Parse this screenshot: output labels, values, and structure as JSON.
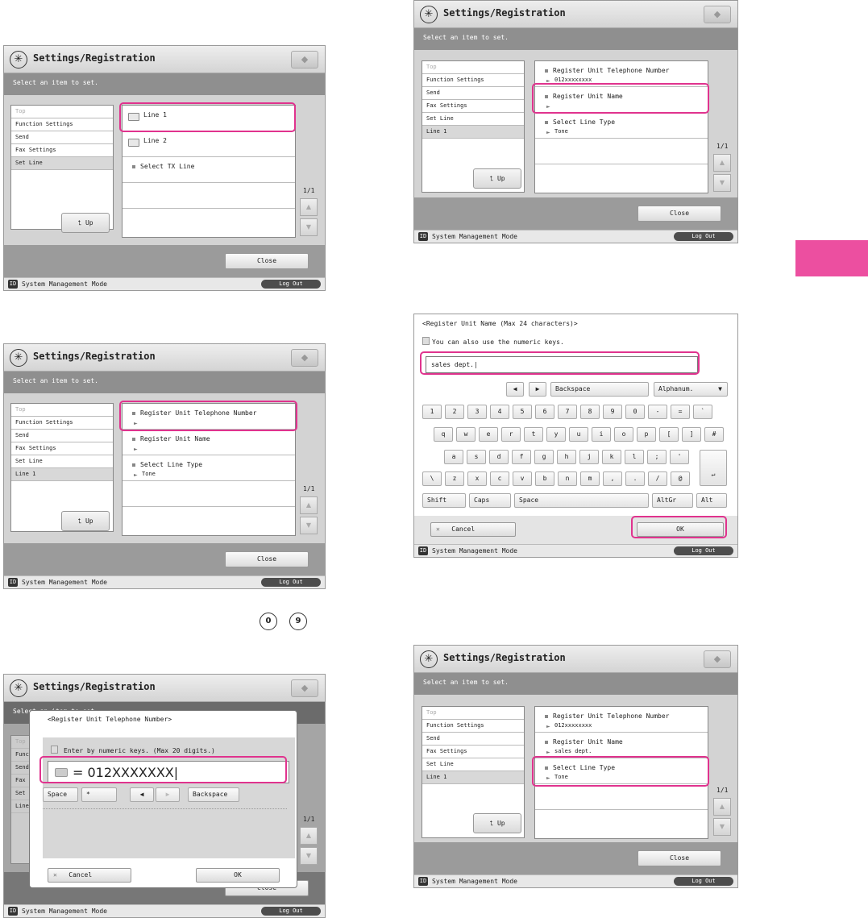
{
  "common": {
    "title": "Settings/Registration",
    "subtitle": "Select an item to set.",
    "close_label": "Close",
    "mode_label": "System Management Mode",
    "logout_label": "Log Out",
    "up_label": "Up",
    "page_indicator": "1/1",
    "tree_items": [
      "Top",
      "Function Settings",
      "Send",
      "Fax Settings",
      "Set Line",
      "Line 1"
    ]
  },
  "screen1": {
    "rows": [
      {
        "label": "Line 1"
      },
      {
        "label": "Line 2"
      },
      {
        "label": "Select TX Line"
      }
    ]
  },
  "screen2": {
    "rows": [
      {
        "label": "Register Unit Telephone Number",
        "value": "012xxxxxxxx"
      },
      {
        "label": "Register Unit Name",
        "value": ""
      },
      {
        "label": "Select Line Type",
        "value": "Tone"
      }
    ]
  },
  "screen3": {
    "rows": [
      {
        "label": "Register Unit Telephone Number",
        "value": ""
      },
      {
        "label": "Register Unit Name",
        "value": ""
      },
      {
        "label": "Select Line Type",
        "value": "Tone"
      }
    ]
  },
  "screen4": {
    "title": "<Register Unit Name (Max 24 characters)>",
    "hint": "You can also use the numeric keys.",
    "input_value": "sales dept.",
    "backspace_label": "Backspace",
    "mode_select": "Alphanum.",
    "row1": [
      "1",
      "2",
      "3",
      "4",
      "5",
      "6",
      "7",
      "8",
      "9",
      "0",
      "-",
      "=",
      "`"
    ],
    "row2": [
      "q",
      "w",
      "e",
      "r",
      "t",
      "y",
      "u",
      "i",
      "o",
      "p",
      "[",
      "]",
      "#"
    ],
    "row3": [
      "a",
      "s",
      "d",
      "f",
      "g",
      "h",
      "j",
      "k",
      "l",
      ";",
      "'"
    ],
    "row4": [
      "\\",
      "z",
      "x",
      "c",
      "v",
      "b",
      "n",
      "m",
      ",",
      ".",
      "/",
      "@"
    ],
    "shift_label": "Shift",
    "caps_label": "Caps",
    "space_label": "Space",
    "altgr_label": "AltGr",
    "alt_label": "Alt",
    "cancel_label": "Cancel",
    "ok_label": "OK"
  },
  "screen5": {
    "dialog_title": "<Register Unit Telephone Number>",
    "hint": "Enter by numeric keys. (Max 20 digits.)",
    "value": "= 012XXXXXXX",
    "space_label": "Space",
    "star_label": "*",
    "backspace_label": "Backspace",
    "cancel_label": "Cancel",
    "ok_label": "OK",
    "bg_subtitle": "Select an item to set.",
    "bg_tree": [
      "Top",
      "Funct",
      "Send",
      "Fax S",
      "Set L",
      "Line"
    ]
  },
  "screen6": {
    "rows": [
      {
        "label": "Register Unit Telephone Number",
        "value": "012xxxxxxxx"
      },
      {
        "label": "Register Unit Name",
        "value": "sales dept."
      },
      {
        "label": "Select Line Type",
        "value": "Tone"
      }
    ]
  },
  "numkeys": [
    "0",
    "9"
  ],
  "colors": {
    "highlight": "#e0338e",
    "tab": "#ec4fa0",
    "subbar": "#8f8f8f"
  }
}
